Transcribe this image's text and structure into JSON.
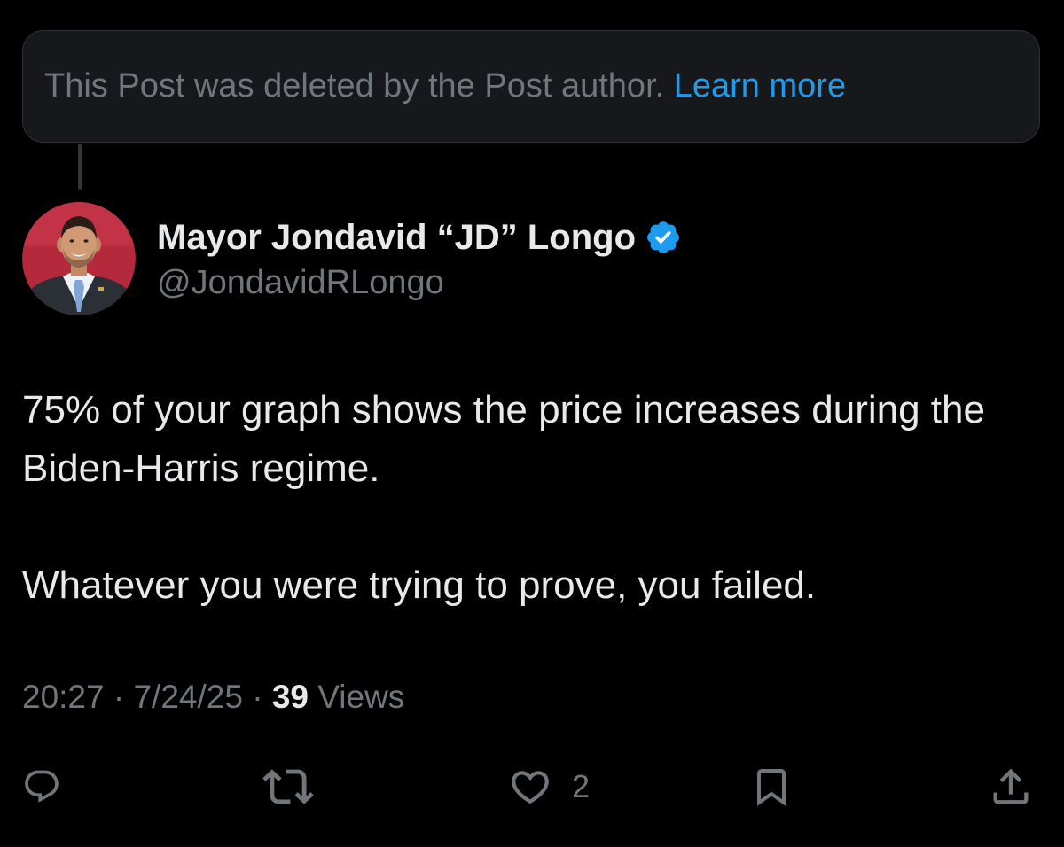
{
  "deleted_notice": {
    "text": "This Post was deleted by the Post author.",
    "link": "Learn more"
  },
  "author": {
    "display_name": "Mayor Jondavid “JD” Longo",
    "handle": "@JondavidRLongo",
    "verified": true
  },
  "post": {
    "paragraphs": [
      "75% of your graph shows the price increases during the Biden-Harris regime.",
      "Whatever you were trying to prove, you failed."
    ]
  },
  "meta": {
    "time": "20:27",
    "date": "7/24/25",
    "separator": "·",
    "views_count": "39",
    "views_label": "Views"
  },
  "actions": {
    "reply": {
      "icon": "reply-icon"
    },
    "repost": {
      "icon": "repost-icon"
    },
    "like": {
      "icon": "heart-icon",
      "count": "2"
    },
    "bookmark": {
      "icon": "bookmark-icon"
    },
    "share": {
      "icon": "share-icon"
    }
  },
  "colors": {
    "background": "#000000",
    "text_primary": "#e7e9ea",
    "text_secondary": "#71767b",
    "link": "#1d9bf0",
    "verified": "#1d9bf0",
    "card_background": "#16181c",
    "border": "#2f3336"
  }
}
